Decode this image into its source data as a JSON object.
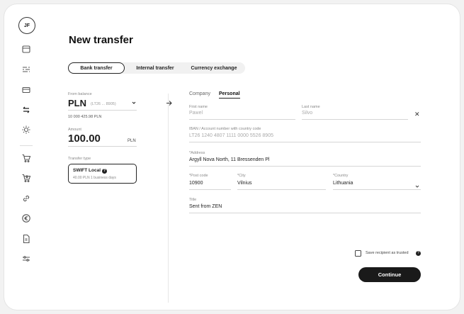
{
  "user": {
    "initials": "JF"
  },
  "sidebar": {
    "icons": [
      "wallet-icon",
      "transactions-icon",
      "card-icon",
      "transfer-icon",
      "sun-icon",
      "cart-icon",
      "cashback-icon",
      "link-icon",
      "euro-icon",
      "document-icon",
      "settings-sliders-icon"
    ]
  },
  "page": {
    "title": "New transfer"
  },
  "tabs": {
    "items": [
      {
        "label": "Bank transfer"
      },
      {
        "label": "Internal transfer"
      },
      {
        "label": "Currency exchange"
      }
    ],
    "active": "Bank transfer"
  },
  "source": {
    "from_label": "From balance",
    "currency": "PLN",
    "account_short": "(LT26 ... 8905)",
    "balance": "10 000 425.98 PLN",
    "amount_label": "Amount",
    "amount": "100.00",
    "amount_currency": "PLN",
    "transfer_type_label": "Transfer type",
    "transfer_type_name": "SWIFT Local",
    "transfer_type_details": "40.00 PLN   1 business days"
  },
  "recipient": {
    "tabs": [
      "Company",
      "Personal"
    ],
    "active_tab": "Personal",
    "first_name_label": "First name",
    "first_name_placeholder": "Pawel",
    "last_name_label": "Last name",
    "last_name_placeholder": "Silvo",
    "iban_label": "IBAN / Account number with country code",
    "iban_placeholder": "LT26 1240 4807 1111 0000 5526 8905",
    "address_label": "*Address",
    "address": "Argyll Nova North, 11 Bressenden Pl",
    "post_code_label": "*Post code",
    "post_code": "10900",
    "city_label": "*City",
    "city": "Vilnius",
    "country_label": "*Country",
    "country": "Lithuania",
    "title_label": "Title",
    "title": "Sent from ZEN"
  },
  "footer": {
    "trusted_label": "Save recipient as trusted",
    "trusted_checked": false,
    "continue_label": "Continue"
  },
  "colors": {
    "primary": "#1a1a1a",
    "background": "#ffffff"
  }
}
